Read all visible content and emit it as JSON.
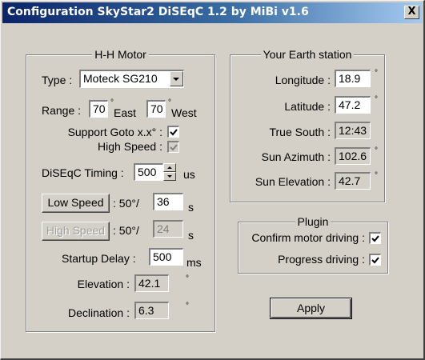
{
  "window": {
    "title": "Configuration SkyStar2 DiSEqC 1.2 by MiBi v1.6",
    "close_glyph": "X"
  },
  "hh_motor": {
    "group_title": "H-H Motor",
    "type_label": "Type :",
    "type_value": "Moteck SG210",
    "range_label": "Range :",
    "range_east_value": "70",
    "range_east_unit": "East",
    "range_west_value": "70",
    "range_west_unit": "West",
    "degree_mark": "°",
    "support_goto_label": "Support Goto x.x° :",
    "support_goto_checked": true,
    "high_speed_label": "High Speed :",
    "high_speed_checked": true,
    "timing_label": "DiSEqC Timing :",
    "timing_value": "500",
    "timing_unit": "us",
    "low_speed_button": "Low Speed",
    "low_speed_rate": ": 50°/",
    "low_speed_value": "36",
    "low_speed_unit": "s",
    "high_speed_button": "High Speed",
    "high_speed_rate": ": 50°/",
    "high_speed_value": "24",
    "high_speed_unit": "s",
    "startup_delay_label": "Startup Delay :",
    "startup_delay_value": "500",
    "startup_delay_unit": "ms",
    "elevation_label": "Elevation :",
    "elevation_value": "42.1",
    "declination_label": "Declination :",
    "declination_value": "6.3"
  },
  "earth_station": {
    "group_title": "Your Earth station",
    "longitude_label": "Longitude :",
    "longitude_value": "18.9",
    "latitude_label": "Latitude :",
    "latitude_value": "47.2",
    "true_south_label": "True South :",
    "true_south_value": "12:43",
    "sun_azimuth_label": "Sun Azimuth :",
    "sun_azimuth_value": "102.6",
    "sun_elevation_label": "Sun Elevation :",
    "sun_elevation_value": "42.7"
  },
  "plugin": {
    "group_title": "Plugin",
    "confirm_label": "Confirm motor driving :",
    "confirm_checked": true,
    "progress_label": "Progress driving :",
    "progress_checked": true
  },
  "apply_button": "Apply"
}
